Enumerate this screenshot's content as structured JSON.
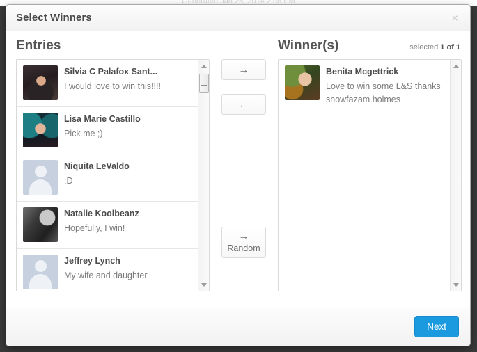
{
  "background": {
    "faint_text": "Generated    Jan 26, 2014 2:08 PM"
  },
  "modal": {
    "title": "Select Winners",
    "close_label": "×",
    "entries_panel": {
      "heading": "Entries",
      "items": [
        {
          "name": "Silvia C Palafox Sant...",
          "message": "I would love to win this!!!!",
          "avatar": "photo-silvia"
        },
        {
          "name": "Lisa Marie Castillo",
          "message": "Pick me ;)",
          "avatar": "photo-lisa"
        },
        {
          "name": "Niquita LeValdo",
          "message": ":D",
          "avatar": "silhouette"
        },
        {
          "name": "Natalie Koolbeanz",
          "message": "Hopefully, I win!",
          "avatar": "photo-natalie"
        },
        {
          "name": "Jeffrey Lynch",
          "message": "My wife and daughter",
          "avatar": "silhouette"
        }
      ]
    },
    "winners_panel": {
      "heading": "Winner(s)",
      "selected_label_prefix": "selected ",
      "selected_label_count": "1 of 1",
      "items": [
        {
          "name": "Benita Mcgettrick",
          "message": "Love to win some L&S thanks snowfazam holmes",
          "avatar": "photo-benita"
        }
      ]
    },
    "transfer": {
      "move_right_icon": "→",
      "move_left_icon": "←",
      "random_icon": "→",
      "random_label": "Random"
    },
    "footer": {
      "next_label": "Next"
    }
  },
  "colors": {
    "accent": "#1b9ae0",
    "heading_text": "#555555",
    "body_text": "#7b7b7b"
  }
}
